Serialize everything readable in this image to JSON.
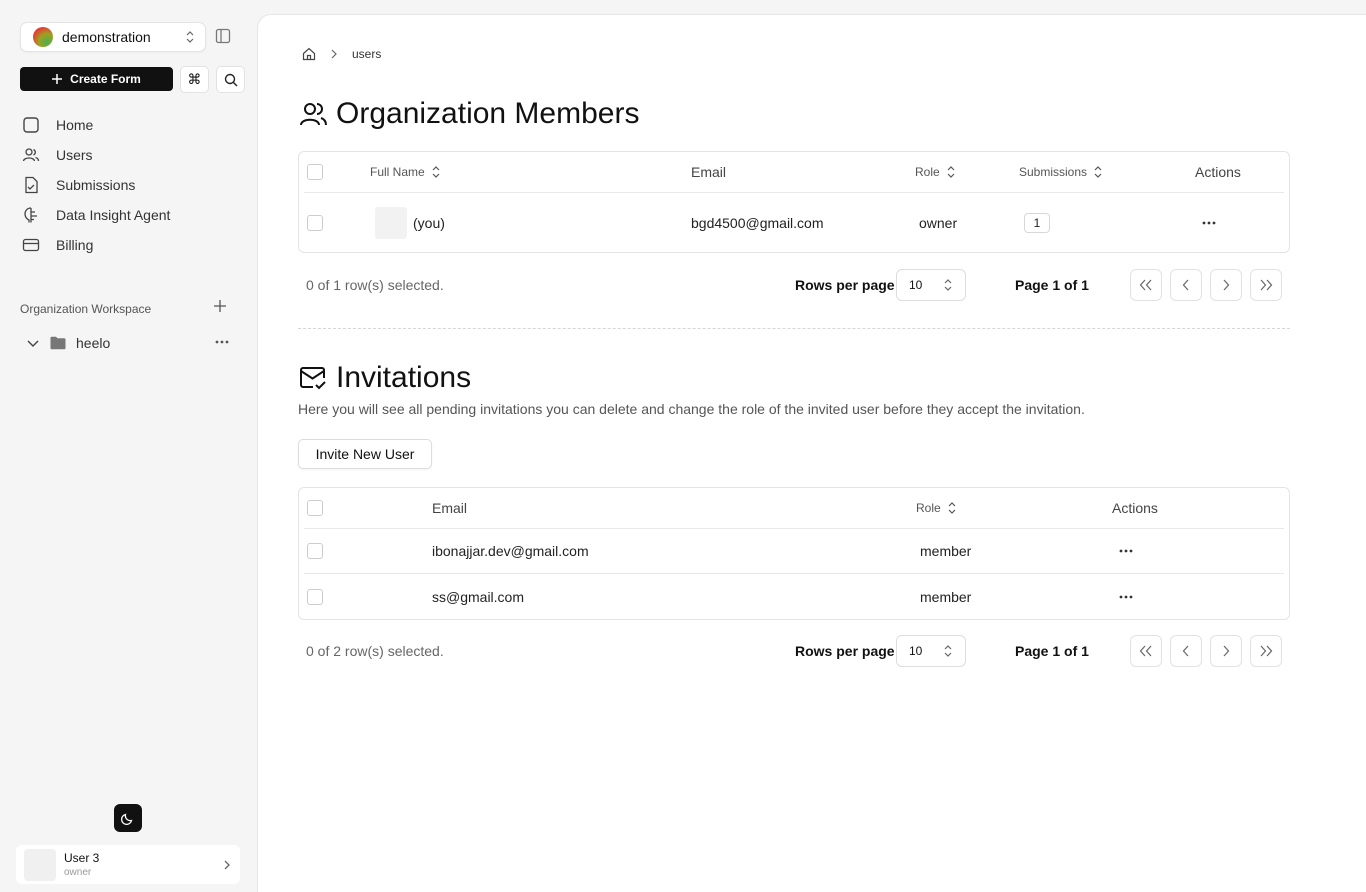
{
  "sidebar": {
    "org_name": "demonstration",
    "create_label": "Create Form",
    "shortcut_symbol": "⌘",
    "nav": [
      {
        "label": "Home",
        "icon": "square-icon"
      },
      {
        "label": "Users",
        "icon": "users-icon"
      },
      {
        "label": "Submissions",
        "icon": "file-icon"
      },
      {
        "label": "Data Insight Agent",
        "icon": "brain-icon"
      },
      {
        "label": "Billing",
        "icon": "card-icon"
      }
    ],
    "workspace_label": "Organization Workspace",
    "folder_name": "heelo",
    "user": {
      "name": "User 3",
      "role": "owner"
    }
  },
  "breadcrumb": {
    "current": "users"
  },
  "members": {
    "title": "Organization Members",
    "headers": {
      "name": "Full Name",
      "email": "Email",
      "role": "Role",
      "submissions": "Submissions",
      "actions": "Actions"
    },
    "rows": [
      {
        "name": "(you)",
        "email": "bgd4500@gmail.com",
        "role": "owner",
        "submissions": "1"
      }
    ],
    "pager": {
      "selected": "0 of 1 row(s) selected.",
      "rows_label": "Rows per page",
      "rows_value": "10",
      "page_info": "Page 1 of 1"
    }
  },
  "invitations": {
    "title": "Invitations",
    "description": "Here you will see all pending invitations you can delete and change the role of the invited user before they accept the invitation.",
    "invite_label": "Invite New User",
    "headers": {
      "email": "Email",
      "role": "Role",
      "actions": "Actions"
    },
    "rows": [
      {
        "email": "ibonajjar.dev@gmail.com",
        "role": "member"
      },
      {
        "email": "ss@gmail.com",
        "role": "member"
      }
    ],
    "pager": {
      "selected": "0 of 2 row(s) selected.",
      "rows_label": "Rows per page",
      "rows_value": "10",
      "page_info": "Page 1 of 1"
    }
  }
}
